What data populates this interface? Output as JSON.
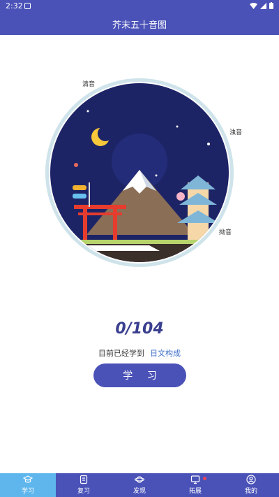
{
  "status": {
    "time": "2:32"
  },
  "appbar": {
    "title": "芥末五十音图"
  },
  "illustration": {
    "labels": {
      "seion": "清音",
      "dakuon": "浊音",
      "youon": "拗音"
    }
  },
  "progress": {
    "count": "0/104",
    "text": "目前已经学到",
    "current": "日文构成"
  },
  "study_button": {
    "label": "学 习"
  },
  "tabs": [
    {
      "label": "学习",
      "icon": "graduation-cap-icon",
      "active": true
    },
    {
      "label": "复习",
      "icon": "document-icon",
      "active": false
    },
    {
      "label": "发现",
      "icon": "planet-icon",
      "active": false
    },
    {
      "label": "拓展",
      "icon": "monitor-icon",
      "active": false,
      "badge": true
    },
    {
      "label": "我的",
      "icon": "user-icon",
      "active": false
    }
  ],
  "colors": {
    "primary": "#4a52b8",
    "active_tab": "#5fb6ec",
    "count": "#3a3f8f",
    "highlight": "#3e6ec7"
  }
}
